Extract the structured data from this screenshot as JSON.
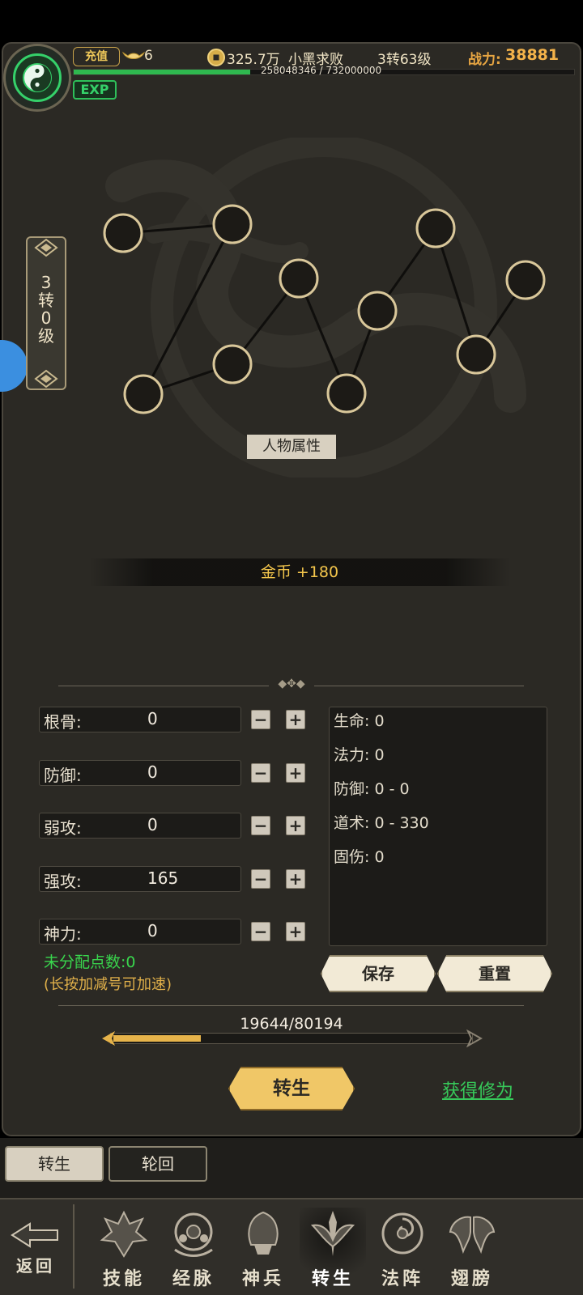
{
  "hud": {
    "recharge_label": "充值",
    "ingot_count": "6",
    "coins": "325.7万",
    "player_name": "小黑求败",
    "player_level": "3转63级",
    "power_label": "战力:",
    "power_value": "38881",
    "exp_text": "258048346 / 732000000",
    "exp_progress": 0.3525,
    "exp_badge": "EXP"
  },
  "rebirth_tag": {
    "line1": "3",
    "line2": "转",
    "line3": "0",
    "line4": "级"
  },
  "attribute_label": "人物属性",
  "reward": "金币  +180",
  "stats": [
    {
      "name": "根骨:",
      "value": "0"
    },
    {
      "name": "防御:",
      "value": "0"
    },
    {
      "name": "弱攻:",
      "value": "0"
    },
    {
      "name": "强攻:",
      "value": "165"
    },
    {
      "name": "神力:",
      "value": "0"
    }
  ],
  "stat_buttons": {
    "minus": "−",
    "plus": "+"
  },
  "derived": [
    "生命: 0",
    "法力: 0",
    "防御: 0 - 0",
    "道术: 0 - 330",
    "固伤: 0"
  ],
  "unassigned": "未分配点数:0",
  "hint": "(长按加减号可加速)",
  "save_label": "保存",
  "reset_label": "重置",
  "progress": {
    "text": "19644/80194",
    "current": 19644,
    "max": 80194
  },
  "rebirth_button": "转生",
  "gain_link": "获得修为",
  "subtabs": [
    {
      "label": "转生",
      "active": true
    },
    {
      "label": "轮回",
      "active": false
    }
  ],
  "nav": {
    "back": "返回",
    "items": [
      {
        "label": "技能",
        "icon": "skills-icon"
      },
      {
        "label": "经脉",
        "icon": "meridian-icon"
      },
      {
        "label": "神兵",
        "icon": "divine-weapon-icon"
      },
      {
        "label": "转生",
        "icon": "rebirth-icon"
      },
      {
        "label": "法阵",
        "icon": "formation-icon"
      },
      {
        "label": "翅膀",
        "icon": "wings-icon"
      }
    ]
  },
  "colors": {
    "accent_gold": "#f0c767",
    "exp_green": "#2fb84f",
    "text_green": "#39d64d"
  }
}
